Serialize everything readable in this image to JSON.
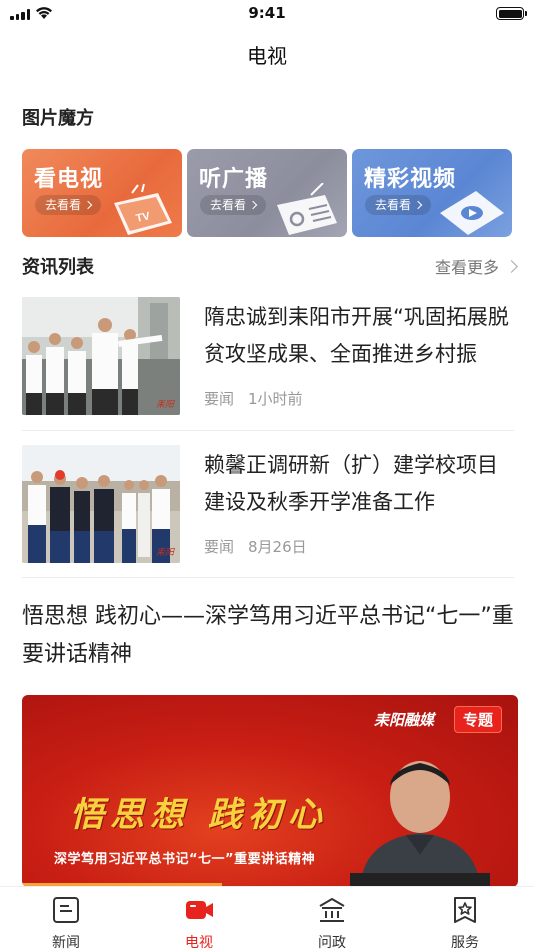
{
  "status_bar": {
    "time": "9:41"
  },
  "nav": {
    "title": "电视"
  },
  "picture_cube": {
    "title": "图片魔方",
    "items": [
      {
        "label": "看电视",
        "action": "去看看",
        "icon": "tv-icon"
      },
      {
        "label": "听广播",
        "action": "去看看",
        "icon": "radio-icon"
      },
      {
        "label": "精彩视频",
        "action": "去看看",
        "icon": "video-play-icon"
      }
    ],
    "colors": [
      "#ec7444",
      "#9496a6",
      "#6690d8"
    ]
  },
  "news_list": {
    "title": "资讯列表",
    "more_label": "查看更多",
    "items": [
      {
        "title": "隋忠诚到耒阳市开展“巩固拓展脱贫攻坚成果、全面推进乡村振兴”调研",
        "category": "要闻",
        "time": "1小时前"
      },
      {
        "title": "赖馨正调研新（扩）建学校项目建设及秋季开学准备工作",
        "category": "要闻",
        "time": "8月26日"
      }
    ],
    "feature": {
      "title": "悟思想 践初心——深学笃用习近平总书记“七一”重要讲话精神",
      "banner_logo": "耒阳融媒",
      "banner_tag": "专题",
      "banner_slogan": "悟思想 践初心",
      "banner_subtitle": "深学笃用习近平总书记“七一”重要讲话精神"
    }
  },
  "tabbar": {
    "items": [
      {
        "label": "新闻",
        "icon": "news-icon",
        "active": false
      },
      {
        "label": "电视",
        "icon": "tv-camera-icon",
        "active": true
      },
      {
        "label": "问政",
        "icon": "government-building-icon",
        "active": false
      },
      {
        "label": "服务",
        "icon": "service-star-icon",
        "active": false
      }
    ],
    "active_color": "#e8231d"
  }
}
